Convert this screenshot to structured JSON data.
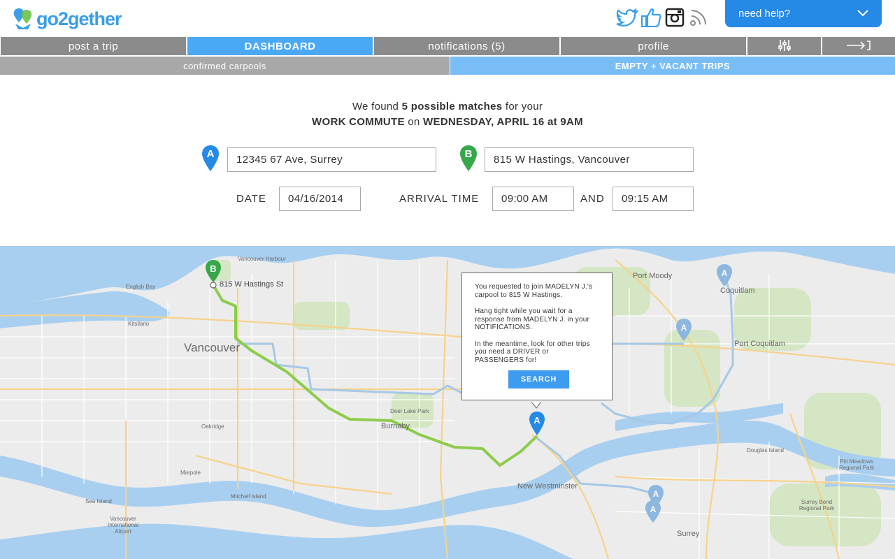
{
  "brand": {
    "name": "go2gether",
    "color": "#3a9ee8"
  },
  "header": {
    "social_icons": [
      "twitter-icon",
      "thumbs-up-icon",
      "instagram-icon",
      "rss-icon"
    ],
    "help_label": "need help?"
  },
  "nav": {
    "tabs": [
      "post a trip",
      "DASHBOARD",
      "notifications (5)",
      "profile"
    ],
    "active_tab": "DASHBOARD",
    "icon_tabs": [
      "settings-sliders-icon",
      "logout-arrow-icon"
    ]
  },
  "subnav": {
    "left": "confirmed carpools",
    "right": "EMPTY + VACANT TRIPS",
    "active": "EMPTY + VACANT TRIPS"
  },
  "summary": {
    "line1_pre": "We found ",
    "line1_bold": "5 possible matches",
    "line1_post": " for your",
    "line2_bold1": "WORK COMMUTE",
    "line2_mid": " on ",
    "line2_bold2": "WEDNESDAY, APRIL 16 at 9AM"
  },
  "form": {
    "from_pin": "A",
    "from_value": "12345 67 Ave, Surrey",
    "to_pin": "B",
    "to_value": "815 W Hastings, Vancouver",
    "date_label": "DATE",
    "date_value": "04/16/2014",
    "arrival_label": "ARRIVAL TIME",
    "time_from": "09:00 AM",
    "and_label": "AND",
    "time_to": "09:15 AM"
  },
  "map": {
    "labels": {
      "vancouver": "Vancouver",
      "burnaby": "Burnaby",
      "new_westminster": "New Westminster",
      "coquitlam": "Coquitlam",
      "port_moody": "Port Moody",
      "port_coquitlam": "Port Coquitlam",
      "surrey": "Surrey",
      "destination": "815 W Hastings St",
      "english_bay": "English Bay",
      "kitsilano": "Kitsilano",
      "sea_island": "Sea Island",
      "airport": "Vancouver International Airport",
      "deer_lake": "Deer Lake Park",
      "pitt_meadows": "Pitt Meadows Regional Park",
      "surrey_bend": "Surrey Bend Regional Park",
      "douglas_island": "Douglas Island",
      "vancouver_harbour": "Vancouver Harbour",
      "mitchell_island": "Mitchell Island",
      "marpole": "Marpole",
      "oakridge": "Oakridge"
    },
    "pin_b": "B",
    "pin_a": "A",
    "route_colors": {
      "primary": "#8ccc4a",
      "alternate": "#a6c8e6"
    }
  },
  "popup": {
    "text1": "You requested to join MADELYN J.'s carpool to 815 W Hastings.",
    "text2": "Hang tight while you wait for a response from MADELYN J. in your NOTIFICATIONS.",
    "text3": "In the meantime, look for other trips you need a DRIVER or PASSENGERS for!",
    "button": "SEARCH"
  }
}
